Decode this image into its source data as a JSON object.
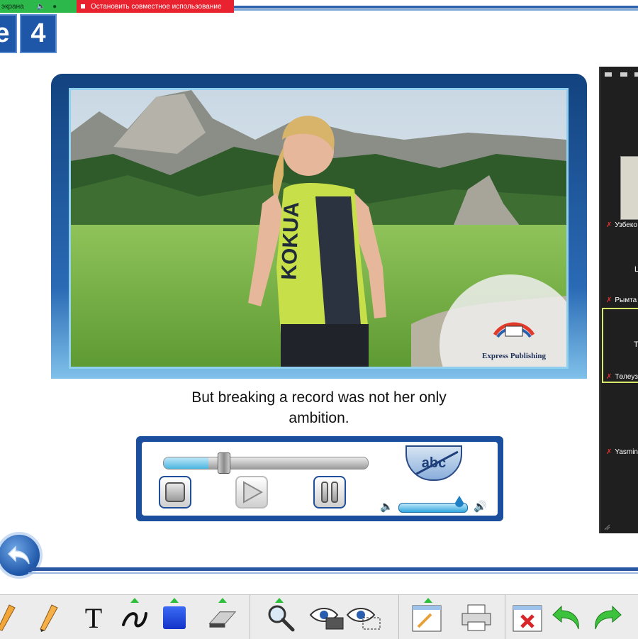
{
  "share_bar": {
    "screen_label": "экрана",
    "stop_sharing_label": "Остановить совместное использование"
  },
  "unit": {
    "letter": "e",
    "number": "4"
  },
  "photo": {
    "publisher_logo_text": "Express Publishing",
    "jersey_text": "KOKUA"
  },
  "caption": {
    "line1": "But breaking a record was not her only",
    "line2": "ambition."
  },
  "player": {
    "subtitle_toggle_label": "abc",
    "progress": 0.22,
    "volume": 0.9
  },
  "participants": [
    {
      "name": "Узбеко",
      "muted": true
    },
    {
      "name": "Рымта",
      "muted": true
    },
    {
      "name": "Төлеуз",
      "muted": true,
      "active": true
    },
    {
      "name": "Yasmin",
      "muted": true
    }
  ],
  "participant_initials": {
    "first": "L",
    "active": "T"
  },
  "toolbar": {
    "text_tool_label": "T",
    "groups": [
      [
        "pencil",
        "marker",
        "text",
        "freehand",
        "shape",
        "eraser"
      ],
      [
        "zoom",
        "reveal",
        "spotlight"
      ],
      [
        "edit-page",
        "print"
      ],
      [
        "close-page",
        "undo",
        "redo"
      ]
    ]
  },
  "colors": {
    "brand_blue": "#1e56a8",
    "share_green": "#2db84b",
    "share_red": "#e8232f",
    "tool_indicator": "#2cbf3a"
  }
}
